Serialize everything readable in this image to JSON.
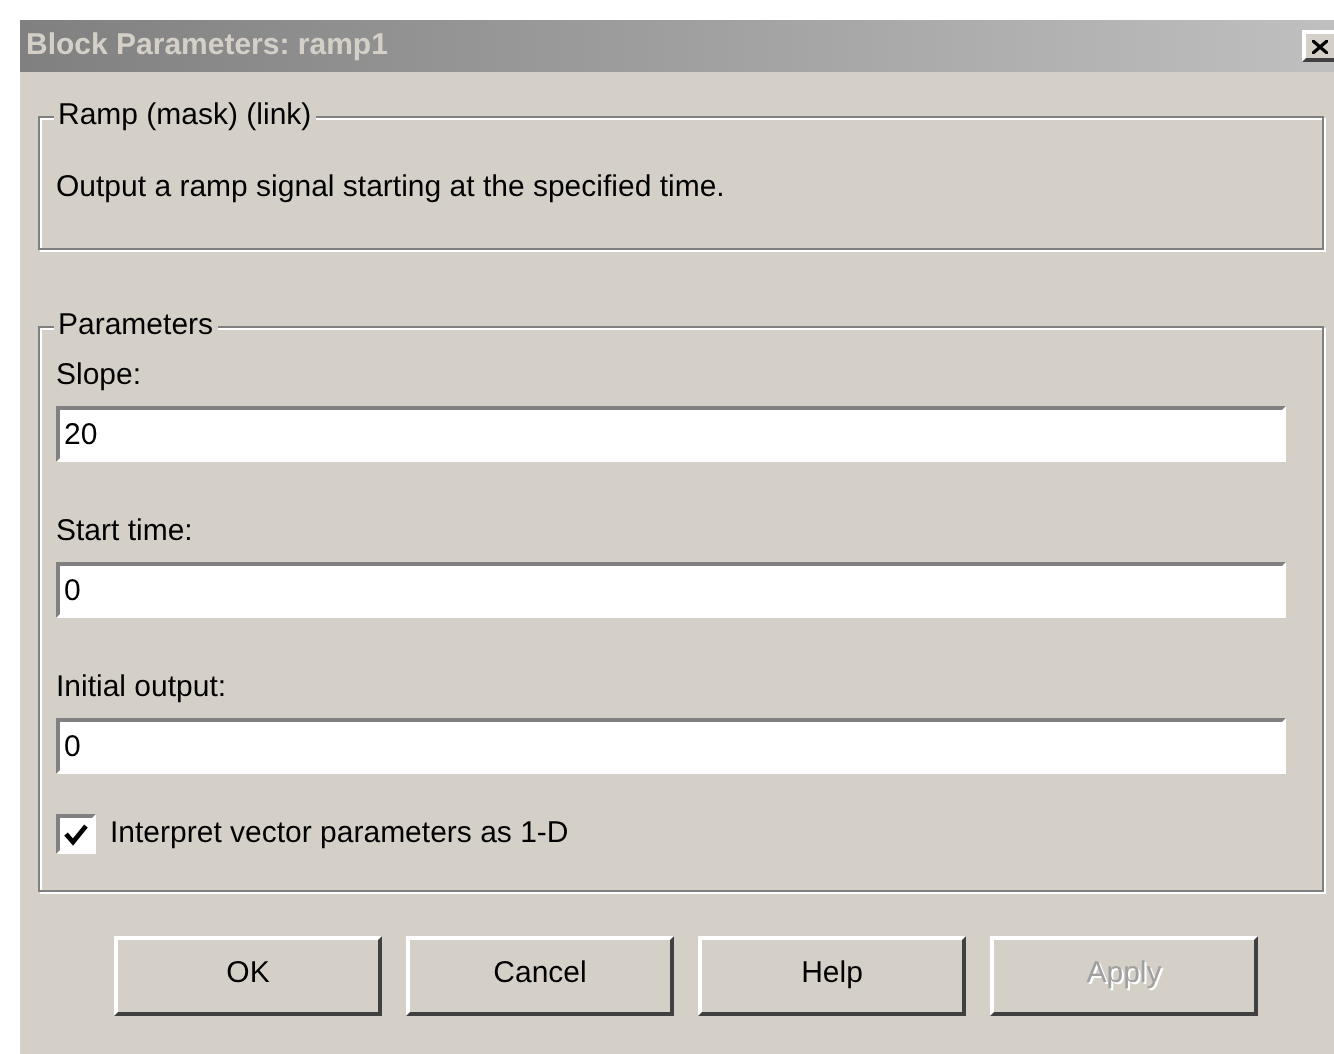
{
  "window": {
    "title": "Block Parameters: ramp1"
  },
  "description_group": {
    "title": "Ramp (mask) (link)",
    "text": "Output a ramp signal starting at the specified time."
  },
  "parameters_group": {
    "title": "Parameters",
    "fields": [
      {
        "label": "Slope:",
        "value": "20"
      },
      {
        "label": "Start time:",
        "value": "0"
      },
      {
        "label": "Initial output:",
        "value": "0"
      }
    ],
    "checkbox": {
      "label": "Interpret vector parameters as 1-D",
      "checked": true
    }
  },
  "buttons": [
    {
      "label": "OK",
      "disabled": false
    },
    {
      "label": "Cancel",
      "disabled": false
    },
    {
      "label": "Help",
      "disabled": false
    },
    {
      "label": "Apply",
      "disabled": true
    }
  ]
}
